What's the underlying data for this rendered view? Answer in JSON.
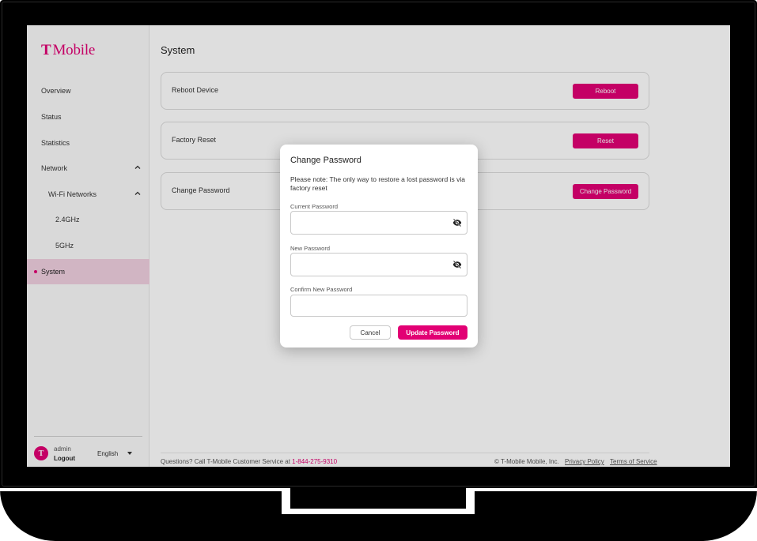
{
  "brand": {
    "logo_text": "Mobile",
    "logo_glyph": "T",
    "accent_color": "#e20074"
  },
  "sidebar": {
    "items": [
      {
        "label": "Overview"
      },
      {
        "label": "Status"
      },
      {
        "label": "Statistics"
      },
      {
        "label": "Network",
        "icon": "chevron-up-icon"
      },
      {
        "label": "Wi-Fi Networks",
        "icon": "chevron-up-icon"
      },
      {
        "label": "2.4GHz"
      },
      {
        "label": "5GHz"
      },
      {
        "label": "System",
        "active": true
      }
    ],
    "user": {
      "name": "admin",
      "logout_label": "Logout",
      "avatar_glyph": "T"
    },
    "language": "English"
  },
  "main": {
    "title": "System",
    "cards": [
      {
        "label": "Reboot Device",
        "button": "Reboot"
      },
      {
        "label": "Factory Reset",
        "button": "Reset"
      },
      {
        "label": "Change Password",
        "button": "Change Password"
      }
    ],
    "footer": {
      "help_text": "Questions? Call T-Mobile Customer Service at ",
      "phone": "1-844-275-9310",
      "copyright": "© T-Mobile Mobile, Inc.",
      "privacy": "Privacy Policy",
      "terms": "Terms of Service"
    }
  },
  "modal": {
    "title": "Change Password",
    "note": "Please note: The only way to restore a lost password is via factory reset",
    "fields": [
      {
        "label": "Current Password",
        "value": "",
        "icon": "eye-off-icon"
      },
      {
        "label": "New Password",
        "value": "",
        "icon": "eye-off-icon"
      },
      {
        "label": "Confirm New Password",
        "value": ""
      }
    ],
    "cancel_label": "Cancel",
    "submit_label": "Update Password"
  }
}
